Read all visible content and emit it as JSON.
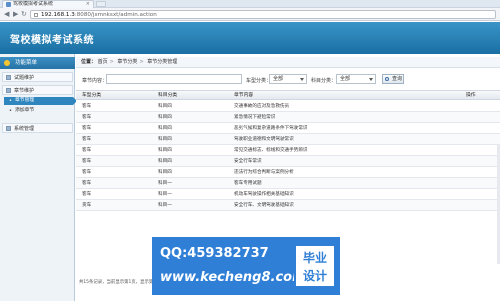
{
  "browser": {
    "tab_title": "驾校模拟考试系统",
    "url_host": "192.168.1.3",
    "url_path": ":8080/jxmnksxt/admin.action"
  },
  "app": {
    "title": "驾校模拟考试系统"
  },
  "sidebar": {
    "header": "功能菜单",
    "items": [
      {
        "label": "试题维护"
      },
      {
        "label": "章节维护"
      }
    ],
    "subitems": [
      {
        "label": "章节管理",
        "active": true
      },
      {
        "label": "添加章节",
        "active": false
      }
    ],
    "bottom_item": "系统管理"
  },
  "breadcrumb": {
    "prefix": "位置：",
    "parts": [
      "首页",
      "章节分类",
      "章节分类管理"
    ]
  },
  "search": {
    "chapter_label": "章节内容：",
    "chapter_value": "",
    "car_type_label": "车型分类：",
    "car_type_value": "全部",
    "subject_label": "科目分类：",
    "subject_value": "全部",
    "query_button": "查询"
  },
  "table": {
    "headers": [
      "车型分类",
      "科目分类",
      "章节内容",
      "操作"
    ],
    "rows": [
      [
        "客车",
        "科目四",
        "交通事故的应对及急救伤员"
      ],
      [
        "客车",
        "科目四",
        "紧急情况下避险常识"
      ],
      [
        "客车",
        "科目四",
        "恶劣气候和复杂道路条件下驾驶常识"
      ],
      [
        "客车",
        "科目四",
        "驾驶职业道德和文明驾驶常识"
      ],
      [
        "客车",
        "科目四",
        "常见交通标志、标线和交通手势辨识"
      ],
      [
        "客车",
        "科目四",
        "安全行车常识"
      ],
      [
        "客车",
        "科目四",
        "违法行为综合判断与案例分析"
      ],
      [
        "客车",
        "科目一",
        "客车专用试题"
      ],
      [
        "客车",
        "科目一",
        "机动车驾驶操作相关基础知识"
      ],
      [
        "货车",
        "科目一",
        "安全行车、文明驾驶基础知识"
      ]
    ],
    "footer": "共15条记录，当前显示第1页，显示第1-10条"
  },
  "watermark": {
    "qq": "QQ:459382737",
    "url": "www.kecheng8.com",
    "badge_line1": "毕业",
    "badge_line2": "设计"
  },
  "colors": {
    "banner": "#2a80b6",
    "sidebar_active": "#2f86bf",
    "watermark_blue": "#2f7fd6"
  }
}
